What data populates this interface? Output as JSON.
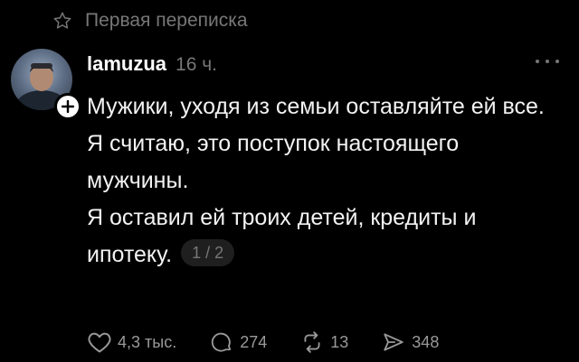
{
  "header": {
    "title": "Первая переписка",
    "icon": "star-icon"
  },
  "post": {
    "author": "lamuzua",
    "time": "16 ч.",
    "lines": [
      "Мужики, уходя из семьи оставляйте ей все.",
      "Я считаю, это поступок настоящего мужчины.",
      "Я оставил ей троих детей, кредиты и ипотеку."
    ],
    "page_indicator": "1 / 2"
  },
  "actions": {
    "likes": "4,3 тыс.",
    "comments": "274",
    "reposts": "13",
    "shares": "348"
  },
  "colors": {
    "background": "#000000",
    "text": "#f3f3f3",
    "muted": "#777777"
  }
}
